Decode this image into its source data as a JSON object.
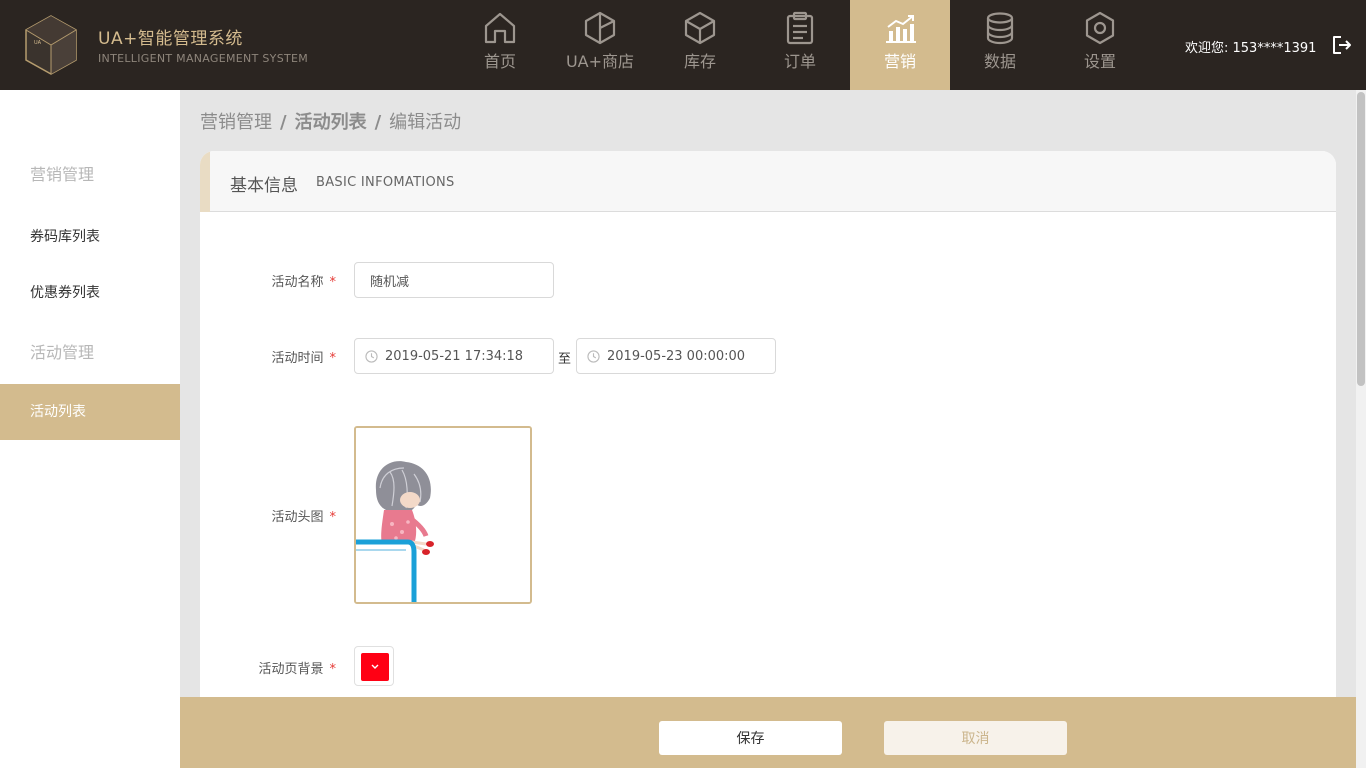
{
  "brand": {
    "title": "UA+智能管理系统",
    "subtitle": "INTELLIGENT MANAGEMENT SYSTEM"
  },
  "nav": {
    "items": [
      {
        "label": "首页",
        "icon": "home-icon"
      },
      {
        "label": "UA+商店",
        "icon": "store-icon"
      },
      {
        "label": "库存",
        "icon": "cube-icon"
      },
      {
        "label": "订单",
        "icon": "clipboard-icon"
      },
      {
        "label": "营销",
        "icon": "chart-up-icon",
        "active": true
      },
      {
        "label": "数据",
        "icon": "database-icon"
      },
      {
        "label": "设置",
        "icon": "hexagon-gear-icon"
      }
    ]
  },
  "user": {
    "welcome": "欢迎您: 153****1391"
  },
  "sidebar": {
    "group1": "营销管理",
    "item1": "券码库列表",
    "item2": "优惠券列表",
    "group2": "活动管理",
    "item3": "活动列表"
  },
  "breadcrumb": {
    "part1": "营销管理",
    "sep": "/",
    "part2": "活动列表",
    "part3": "编辑活动"
  },
  "panel": {
    "title": "基本信息",
    "title_en": "BASIC INFOMATIONS"
  },
  "form": {
    "name_label": "活动名称",
    "name_value": "随机减",
    "time_label": "活动时间",
    "start": "2019-05-21 17:34:18",
    "to": "至",
    "end": "2019-05-23 00:00:00",
    "image_label": "活动头图",
    "bg_label": "活动页背景",
    "bg_color": "#ff0014",
    "required_mark": "*"
  },
  "footer": {
    "save": "保存",
    "cancel": "取消"
  },
  "colors": {
    "accent": "#d3bb8e",
    "topbar": "#2b2521"
  }
}
